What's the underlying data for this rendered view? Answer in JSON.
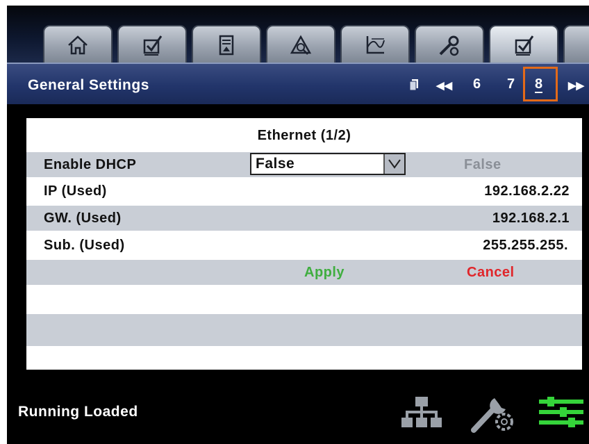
{
  "tabs": [
    {
      "icon": "home-icon"
    },
    {
      "icon": "checkbox-icon"
    },
    {
      "icon": "report-icon"
    },
    {
      "icon": "warning-icon"
    },
    {
      "icon": "graph-icon"
    },
    {
      "icon": "service-tool-icon"
    },
    {
      "icon": "checkbox-icon",
      "active": true
    },
    {
      "icon": "partial-tab-icon"
    }
  ],
  "header": {
    "title": "General Settings",
    "pager": {
      "prev": "◀◀",
      "next": "▶▶",
      "pages": [
        "6",
        "7",
        "8"
      ],
      "current": "8"
    }
  },
  "panel": {
    "title": "Ethernet (1/2)",
    "rows": {
      "dhcp": {
        "label": "Enable DHCP",
        "selected": "False",
        "current": "False"
      },
      "ip": {
        "label": "IP (Used)",
        "value": "192.168.2.22"
      },
      "gw": {
        "label": "GW. (Used)",
        "value": "192.168.2.1"
      },
      "sub": {
        "label": "Sub. (Used)",
        "value": "255.255.255."
      }
    },
    "actions": {
      "apply": "Apply",
      "cancel": "Cancel"
    }
  },
  "footer": {
    "status": "Running Loaded",
    "icons": [
      "network-icon",
      "service-icon",
      "control-icon"
    ]
  },
  "colors": {
    "header_bg": "#22356b",
    "apply": "#3fae3f",
    "cancel": "#e0262b",
    "highlight": "#e36a19",
    "control_icon": "#35d43a"
  }
}
